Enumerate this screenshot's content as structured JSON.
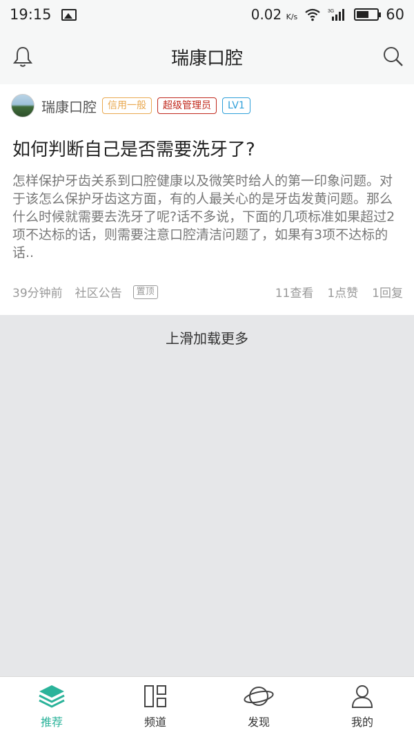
{
  "status_bar": {
    "time": "19:15",
    "speed": "0.02",
    "speed_unit": "K/s",
    "network": "3G",
    "battery": "60",
    "battery_level": 0.6
  },
  "header": {
    "title": "瑞康口腔"
  },
  "post": {
    "author": "瑞康口腔",
    "badges": {
      "credit": "信用一般",
      "role": "超级管理员",
      "level": "LV1"
    },
    "title": "如何判断自己是否需要洗牙了?",
    "excerpt": "怎样保护牙齿关系到口腔健康以及微笑时给人的第一印象问题。对于该怎么保护牙齿这方面，有的人最关心的是牙齿发黄问题。那么什么时候就需要去洗牙了呢?话不多说，下面的几项标准如果超过2项不达标的话，则需要注意口腔清洁问题了，如果有3项不达标的话..",
    "time": "39分钟前",
    "category": "社区公告",
    "pinned": "置顶",
    "views": "11查看",
    "likes": "1点赞",
    "replies": "1回复"
  },
  "load_more": "上滑加载更多",
  "tabs": [
    {
      "label": "推荐",
      "icon": "layers-icon",
      "active": true
    },
    {
      "label": "频道",
      "icon": "grid-icon",
      "active": false
    },
    {
      "label": "发现",
      "icon": "planet-icon",
      "active": false
    },
    {
      "label": "我的",
      "icon": "person-icon",
      "active": false
    }
  ],
  "colors": {
    "accent": "#2bb39a",
    "credit": "#e9a84f",
    "admin": "#c0281c",
    "level": "#2d9fd9"
  }
}
